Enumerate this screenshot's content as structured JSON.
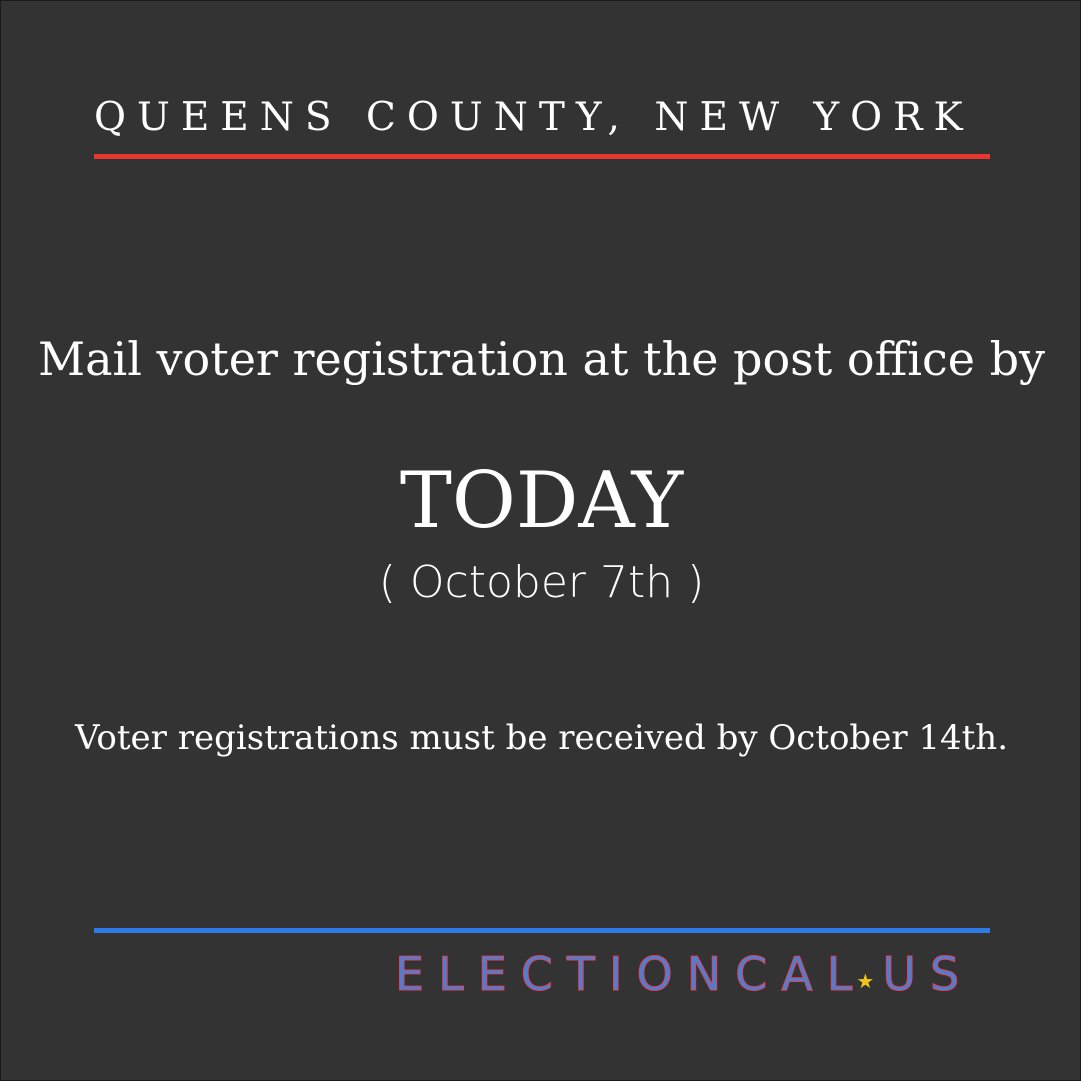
{
  "location": "QUEENS COUNTY, NEW YORK",
  "headline": "Mail voter registration at the post office by",
  "deadline_label": "TODAY",
  "deadline_date": "( October 7th )",
  "note": "Voter registrations must be received by October 14th.",
  "brand": {
    "part_a": "ELECTIONCAL",
    "star_icon": "star-icon",
    "part_b": "US"
  },
  "colors": {
    "background": "#333333",
    "top_rule": "#e8372e",
    "bottom_rule": "#2e7ae6",
    "brand_blue": "#4a7fd4",
    "brand_red": "#e0435a",
    "star": "#f2c31b"
  }
}
